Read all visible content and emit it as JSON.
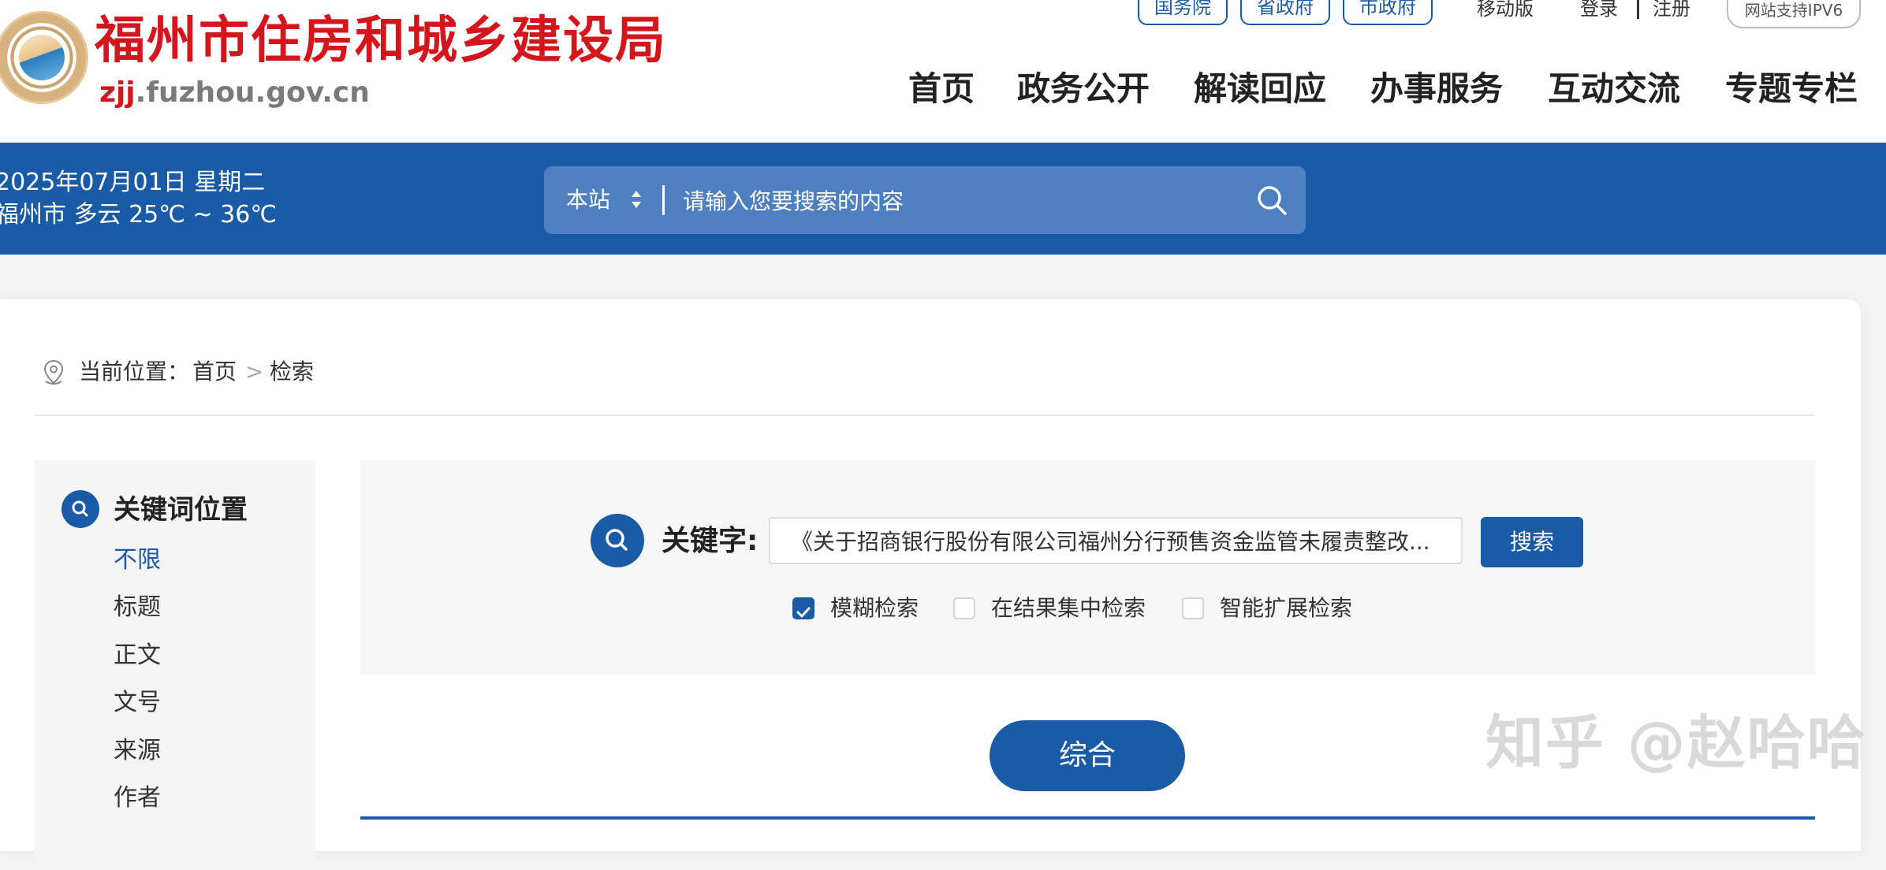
{
  "header": {
    "site_title": "福州市住房和城乡建设局",
    "domain_prefix": "zjj",
    "domain_suffix": ".fuzhou.gov.cn",
    "gov_links": [
      "国务院",
      "省政府",
      "市政府"
    ],
    "mobile": "移动版",
    "login": "登录",
    "register": "注册",
    "ipv6": "网站支持IPV6",
    "nav": [
      "首页",
      "政务公开",
      "解读回应",
      "办事服务",
      "互动交流",
      "专题专栏"
    ]
  },
  "bluebar": {
    "date": "2025年07月01日 星期二",
    "weather": "福州市 多云 25℃ ~ 36℃",
    "scope": "本站",
    "search_placeholder": "请输入您要搜索的内容"
  },
  "breadcrumb": {
    "prefix": "当前位置：",
    "home": "首页",
    "sep": ">",
    "current": "检索"
  },
  "sidebar": {
    "title": "关键词位置",
    "items": [
      "不限",
      "标题",
      "正文",
      "文号",
      "来源",
      "作者"
    ],
    "active_index": 0
  },
  "search": {
    "label": "关键字:",
    "value": "《关于招商银行股份有限公司福州分行预售资金监管未履责整改...",
    "button": "搜索",
    "options": [
      {
        "label": "模糊检索",
        "checked": true
      },
      {
        "label": "在结果集中检索",
        "checked": false
      },
      {
        "label": "智能扩展检索",
        "checked": false
      }
    ]
  },
  "tabs": [
    "综合"
  ],
  "watermark": "知乎 @赵哈哈",
  "colors": {
    "brand_blue": "#1a5ba8",
    "title_red": "#d3161c"
  }
}
